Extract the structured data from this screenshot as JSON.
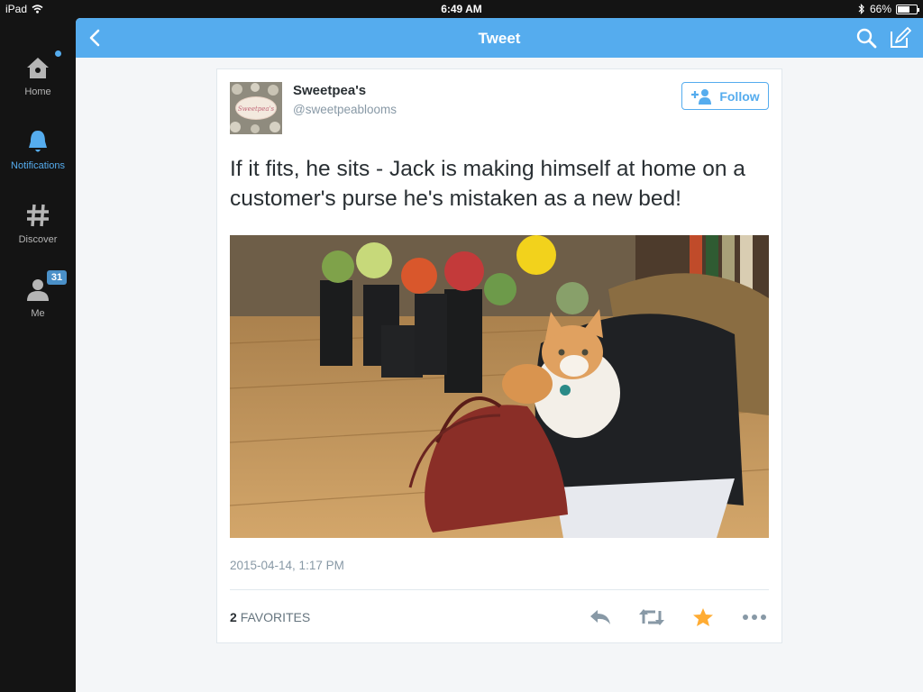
{
  "status_bar": {
    "device": "iPad",
    "time": "6:49 AM",
    "battery": "66%",
    "battery_level": 0.66
  },
  "sidebar": {
    "items": [
      {
        "label": "Home",
        "icon": "home-icon"
      },
      {
        "label": "Notifications",
        "icon": "bell-icon"
      },
      {
        "label": "Discover",
        "icon": "hashtag-icon"
      },
      {
        "label": "Me",
        "icon": "person-icon",
        "badge": "31"
      }
    ]
  },
  "header": {
    "title": "Tweet"
  },
  "tweet": {
    "name": "Sweetpea's",
    "handle": "@sweetpeablooms",
    "avatar_text": "Sweetpea's",
    "follow_label": "Follow",
    "text": "If it fits, he sits - Jack is making himself at home on a customer's purse he's mistaken as a new bed!",
    "timestamp": "2015-04-14, 1:17 PM",
    "favorites_count": "2",
    "favorites_label": "FAVORITES"
  },
  "colors": {
    "brand": "#55acee",
    "star": "#ffac33",
    "sidebar_bg": "#141414"
  }
}
